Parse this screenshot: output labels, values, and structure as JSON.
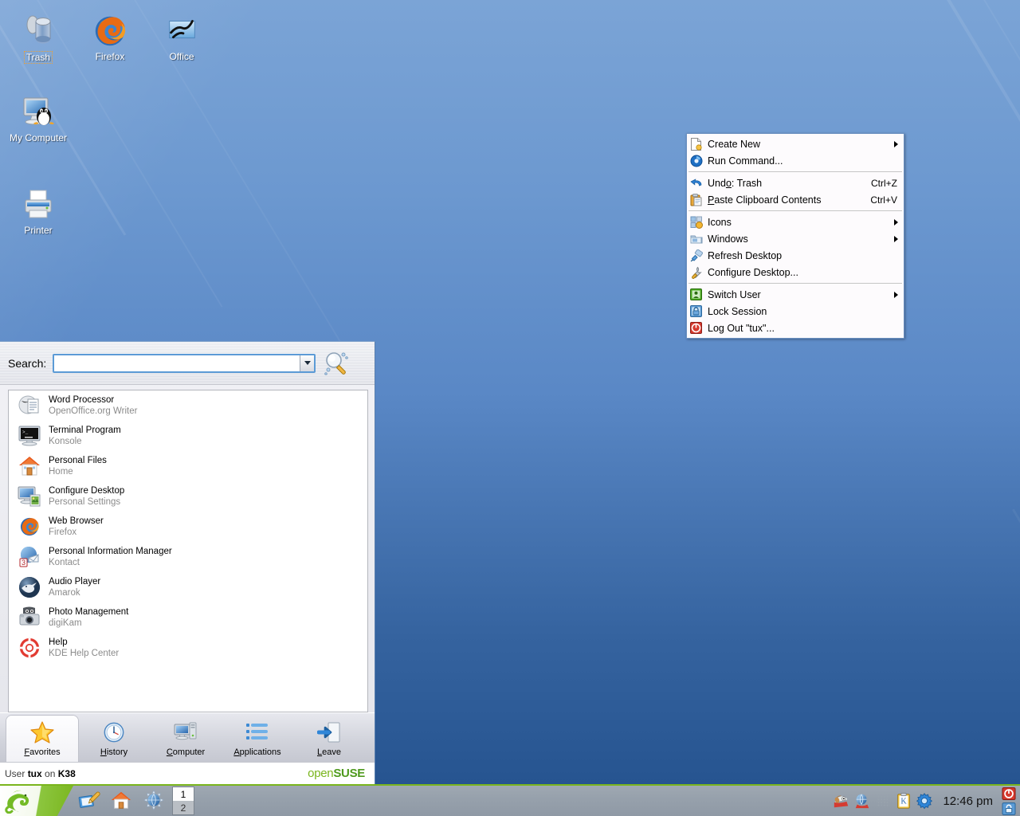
{
  "desktop": {
    "wallpaper_top_color": "#7ba4d6",
    "wallpaper_bottom_color": "#23518d",
    "icons": [
      {
        "label": "Trash",
        "icon": "trash-icon",
        "selected": true
      },
      {
        "label": "Firefox",
        "icon": "firefox-icon",
        "selected": false
      },
      {
        "label": "Office",
        "icon": "openoffice-icon",
        "selected": false
      },
      {
        "label": "My Computer",
        "icon": "my-computer-icon",
        "selected": false
      },
      {
        "label": "Printer",
        "icon": "printer-icon",
        "selected": false
      }
    ]
  },
  "context_menu": {
    "items": [
      {
        "label": "Create New",
        "icon": "new-document-icon",
        "accel": "",
        "submenu": true,
        "type": "item"
      },
      {
        "label": "Run Command...",
        "icon": "run-command-icon",
        "accel": "",
        "submenu": false,
        "type": "item"
      },
      {
        "type": "separator"
      },
      {
        "label": "Undo: Trash",
        "underline": "o",
        "icon": "undo-arrow-icon",
        "accel": "Ctrl+Z",
        "submenu": false,
        "type": "item"
      },
      {
        "label": "Paste Clipboard Contents",
        "underline": "P",
        "icon": "clipboard-paste-icon",
        "accel": "Ctrl+V",
        "submenu": false,
        "type": "item"
      },
      {
        "type": "separator"
      },
      {
        "label": "Icons",
        "icon": "icons-settings-icon",
        "accel": "",
        "submenu": true,
        "type": "item"
      },
      {
        "label": "Windows",
        "icon": "windows-folder-icon",
        "accel": "",
        "submenu": true,
        "type": "item"
      },
      {
        "label": "Refresh Desktop",
        "icon": "refresh-broom-icon",
        "accel": "",
        "submenu": false,
        "type": "item"
      },
      {
        "label": "Configure Desktop...",
        "icon": "wrench-icon",
        "accel": "",
        "submenu": false,
        "type": "item"
      },
      {
        "type": "separator"
      },
      {
        "label": "Switch User",
        "icon": "switch-user-icon",
        "accel": "",
        "submenu": true,
        "type": "item"
      },
      {
        "label": "Lock Session",
        "icon": "lock-session-icon",
        "accel": "",
        "submenu": false,
        "type": "item"
      },
      {
        "label": "Log Out \"tux\"...",
        "icon": "logout-power-icon",
        "accel": "",
        "submenu": false,
        "type": "item"
      }
    ]
  },
  "kmenu": {
    "search": {
      "label": "Search:",
      "value": "",
      "placeholder": ""
    },
    "favorites": [
      {
        "title": "Word Processor",
        "subtitle": "OpenOffice.org Writer",
        "icon": "writer-icon"
      },
      {
        "title": "Terminal Program",
        "subtitle": "Konsole",
        "icon": "konsole-icon"
      },
      {
        "title": "Personal Files",
        "subtitle": "Home",
        "icon": "home-folder-icon"
      },
      {
        "title": "Configure Desktop",
        "subtitle": "Personal Settings",
        "icon": "configure-desktop-icon"
      },
      {
        "title": "Web Browser",
        "subtitle": "Firefox",
        "icon": "firefox-icon"
      },
      {
        "title": "Personal Information Manager",
        "subtitle": "Kontact",
        "icon": "kontact-icon"
      },
      {
        "title": "Audio Player",
        "subtitle": "Amarok",
        "icon": "amarok-wolf-icon"
      },
      {
        "title": "Photo Management",
        "subtitle": "digiKam",
        "icon": "digikam-camera-icon"
      },
      {
        "title": "Help",
        "subtitle": "KDE Help Center",
        "icon": "lifebuoy-help-icon"
      }
    ],
    "tabs": [
      {
        "label": "Favorites",
        "underline": "F",
        "icon": "star-icon",
        "active": true
      },
      {
        "label": "History",
        "underline": "H",
        "icon": "clock-icon",
        "active": false
      },
      {
        "label": "Computer",
        "underline": "C",
        "icon": "computer-icon",
        "active": false
      },
      {
        "label": "Applications",
        "underline": "A",
        "icon": "applications-list-icon",
        "active": false
      },
      {
        "label": "Leave",
        "underline": "L",
        "icon": "leave-door-icon",
        "active": false
      }
    ],
    "footer": {
      "prefix": "User",
      "user": "tux",
      "middle": "on",
      "host": "K38",
      "brand_open": "open",
      "brand_suse": "SUSE",
      "brand_tm": "™"
    }
  },
  "taskbar": {
    "start_button": "suse-chameleon-icon",
    "launchers": [
      {
        "icon": "show-desktop-icon",
        "name": "show-desktop"
      },
      {
        "icon": "home-folder-icon",
        "name": "home-folder"
      },
      {
        "icon": "konqueror-globe-icon",
        "name": "konqueror"
      }
    ],
    "pager": {
      "desktops": [
        "1",
        "2"
      ],
      "active": "1"
    },
    "tray": [
      {
        "icon": "kget-dog-icon",
        "name": "kget"
      },
      {
        "icon": "klipper-globe-icon",
        "name": "network-manager"
      },
      {
        "icon": "print-queue-icon",
        "name": "print-manager"
      },
      {
        "icon": "klipper-clipboard-icon",
        "name": "klipper"
      },
      {
        "icon": "gear-icon",
        "name": "system-settings"
      }
    ],
    "clock": "12:46 pm",
    "system_buttons": [
      {
        "icon": "logout-power-icon",
        "name": "logout-button"
      },
      {
        "icon": "lock-session-icon",
        "name": "lock-button"
      }
    ]
  }
}
